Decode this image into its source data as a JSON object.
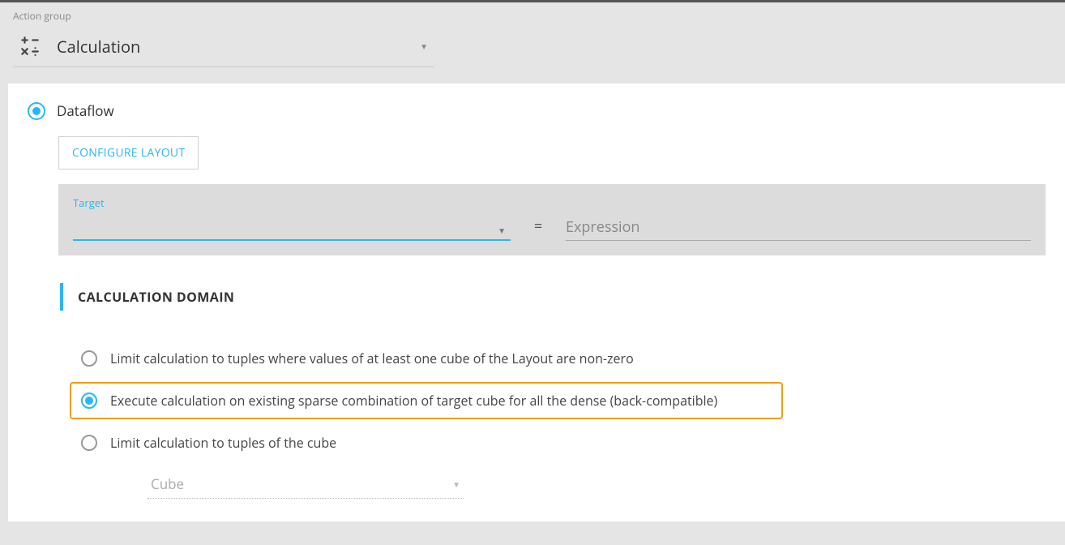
{
  "header": {
    "action_group_label": "Action group",
    "title": "Calculation"
  },
  "dataflow": {
    "label": "Dataflow",
    "configure_btn": "CONFIGURE LAYOUT"
  },
  "expr": {
    "target_label": "Target",
    "equals": "=",
    "expression_placeholder": "Expression"
  },
  "domain": {
    "header": "CALCULATION DOMAIN",
    "opt1": "Limit calculation to tuples where values of at least one cube of the Layout are non-zero",
    "opt2": "Execute calculation on existing sparse combination of target cube for all the dense (back-compatible)",
    "opt3": "Limit calculation to tuples of the cube",
    "cube_placeholder": "Cube"
  }
}
